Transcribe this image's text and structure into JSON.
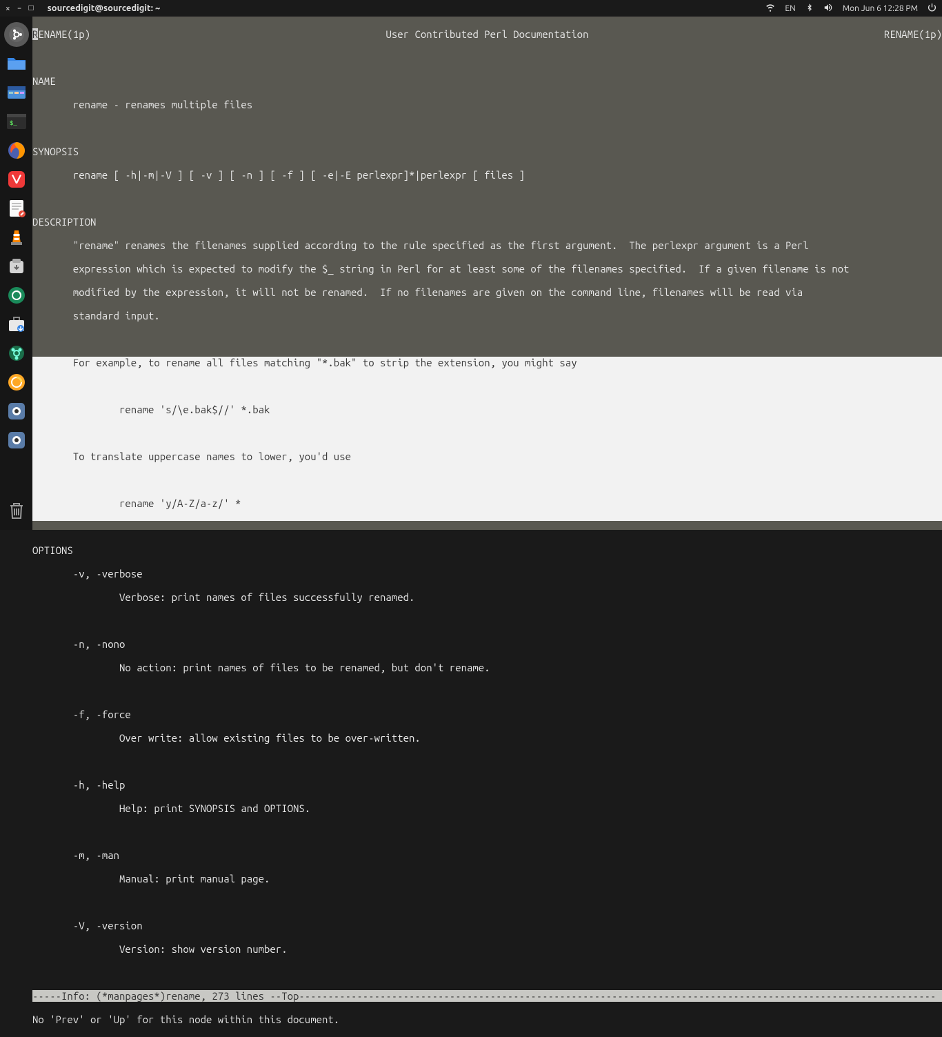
{
  "topbar": {
    "title": "sourcedigit@sourcedigit: ~",
    "lang": "EN",
    "clock": "Mon Jun  6 12:28 PM"
  },
  "dock": {
    "items": [
      "ubuntu",
      "files",
      "files2",
      "terminal",
      "firefox",
      "vivaldi",
      "editor",
      "vlc",
      "archive",
      "camera",
      "software",
      "help",
      "games",
      "screenshot",
      "screenshot2"
    ]
  },
  "man": {
    "header_left": "RENAME(1p)",
    "header_center": "User Contributed Perl Documentation",
    "header_right": "RENAME(1p)",
    "name_head": "NAME",
    "name_body": "       rename - renames multiple files",
    "synopsis_head": "SYNOPSIS",
    "synopsis_body": "       rename [ -h|-m|-V ] [ -v ] [ -n ] [ -f ] [ -e|-E perlexpr]*|perlexpr [ files ]",
    "desc_head": "DESCRIPTION",
    "desc_p1_l1": "       \"rename\" renames the filenames supplied according to the rule specified as the first argument.  The perlexpr argument is a Perl",
    "desc_p1_l2": "       expression which is expected to modify the $_ string in Perl for at least some of the filenames specified.  If a given filename is not",
    "desc_p1_l3": "       modified by the expression, it will not be renamed.  If no filenames are given on the command line, filenames will be read via",
    "desc_p1_l4": "       standard input.",
    "desc_p2": "       For example, to rename all files matching \"*.bak\" to strip the extension, you might say",
    "desc_cmd1": "               rename 's/\\e.bak$//' *.bak",
    "desc_p3": "       To translate uppercase names to lower, you'd use",
    "desc_cmd2": "               rename 'y/A-Z/a-z/' *",
    "opt_head": "OPTIONS",
    "opt_v": "       -v, -verbose",
    "opt_v_desc": "               Verbose: print names of files successfully renamed.",
    "opt_n": "       -n, -nono",
    "opt_n_desc": "               No action: print names of files to be renamed, but don't rename.",
    "opt_f": "       -f, -force",
    "opt_f_desc": "               Over write: allow existing files to be over-written.",
    "opt_h": "       -h, -help",
    "opt_h_desc": "               Help: print SYNOPSIS and OPTIONS.",
    "opt_m": "       -m, -man",
    "opt_m_desc": "               Manual: print manual page.",
    "opt_V": "       -V, -version",
    "opt_V_desc": "               Version: show version number.",
    "modeline": "-----Info: (*manpages*)rename, 273 lines --Top--------------------------------------------------------------------------------------------------------------",
    "bottommsg": "No 'Prev' or 'Up' for this node within this document."
  }
}
